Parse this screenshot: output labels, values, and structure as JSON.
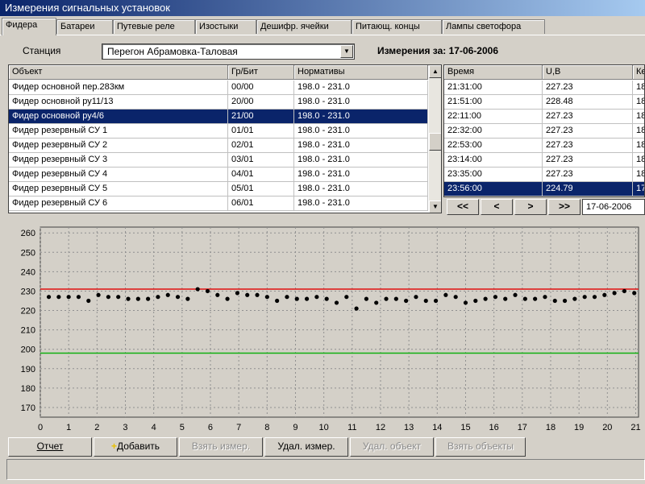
{
  "window": {
    "title": "Измерения сигнальных установок"
  },
  "tabs": [
    {
      "label": "Фидера",
      "active": true
    },
    {
      "label": "Батареи",
      "active": false
    },
    {
      "label": "Путевые реле",
      "active": false
    },
    {
      "label": "Изостыки",
      "active": false
    },
    {
      "label": "Дешифр. ячейки",
      "active": false
    },
    {
      "label": "Питающ. концы",
      "active": false
    },
    {
      "label": "Лампы светофора",
      "active": false
    }
  ],
  "station": {
    "label": "Станция",
    "value": "Перегон Абрамовка-Таловая"
  },
  "measure_date": {
    "text": "Измерения за: 17-06-2006"
  },
  "objects_table": {
    "headers": [
      "Объект",
      "Гр/Бит",
      "Нормативы"
    ],
    "rows": [
      {
        "object": "Фидер основной пер.283км",
        "grbit": "00/00",
        "norm": "198.0 - 231.0",
        "selected": false
      },
      {
        "object": "Фидер основной ру11/13",
        "grbit": "20/00",
        "norm": "198.0 - 231.0",
        "selected": false
      },
      {
        "object": "Фидер основной ру4/6",
        "grbit": "21/00",
        "norm": "198.0 - 231.0",
        "selected": true
      },
      {
        "object": "Фидер резервный СУ 1",
        "grbit": "01/01",
        "norm": "198.0 - 231.0",
        "selected": false
      },
      {
        "object": "Фидер резервный СУ 2",
        "grbit": "02/01",
        "norm": "198.0 - 231.0",
        "selected": false
      },
      {
        "object": "Фидер резервный СУ 3",
        "grbit": "03/01",
        "norm": "198.0 - 231.0",
        "selected": false
      },
      {
        "object": "Фидер резервный СУ 4",
        "grbit": "04/01",
        "norm": "198.0 - 231.0",
        "selected": false
      },
      {
        "object": "Фидер резервный СУ 5",
        "grbit": "05/01",
        "norm": "198.0 - 231.0",
        "selected": false
      },
      {
        "object": "Фидер резервный СУ 6",
        "grbit": "06/01",
        "norm": "198.0 - 231.0",
        "selected": false
      }
    ]
  },
  "measurements_table": {
    "headers": [
      "Время",
      "U,B",
      "Ке"
    ],
    "rows": [
      {
        "time": "21:31:00",
        "u": "227.23",
        "k": "18",
        "selected": false
      },
      {
        "time": "21:51:00",
        "u": "228.48",
        "k": "18",
        "selected": false
      },
      {
        "time": "22:11:00",
        "u": "227.23",
        "k": "18",
        "selected": false
      },
      {
        "time": "22:32:00",
        "u": "227.23",
        "k": "18",
        "selected": false
      },
      {
        "time": "22:53:00",
        "u": "227.23",
        "k": "18",
        "selected": false
      },
      {
        "time": "23:14:00",
        "u": "227.23",
        "k": "18",
        "selected": false
      },
      {
        "time": "23:35:00",
        "u": "227.23",
        "k": "18",
        "selected": false
      },
      {
        "time": "23:56:00",
        "u": "224.79",
        "k": "17",
        "selected": true
      }
    ]
  },
  "nav": {
    "first": "<<",
    "prev": "<",
    "next": ">",
    "last": ">>",
    "date": "17-06-2006"
  },
  "chart_data": {
    "type": "scatter",
    "ylim": [
      165,
      263
    ],
    "xlim": [
      0,
      21.1
    ],
    "yticks": [
      170,
      180,
      190,
      200,
      210,
      220,
      230,
      240,
      250,
      260
    ],
    "xticks": [
      0,
      1,
      2,
      3,
      4,
      5,
      6,
      7,
      8,
      9,
      10,
      11,
      12,
      13,
      14,
      15,
      16,
      17,
      18,
      19,
      20,
      21
    ],
    "upper_limit": 231,
    "lower_limit": 198,
    "upper_color": "#e01010",
    "lower_color": "#10b010",
    "grid": true,
    "x": [
      0.3,
      0.65,
      1.0,
      1.35,
      1.7,
      2.05,
      2.4,
      2.75,
      3.1,
      3.45,
      3.8,
      4.15,
      4.5,
      4.85,
      5.2,
      5.55,
      5.9,
      6.25,
      6.6,
      6.95,
      7.3,
      7.65,
      8.0,
      8.35,
      8.7,
      9.05,
      9.4,
      9.75,
      10.1,
      10.45,
      10.8,
      11.15,
      11.5,
      11.85,
      12.2,
      12.55,
      12.9,
      13.25,
      13.6,
      13.95,
      14.3,
      14.65,
      15.0,
      15.35,
      15.7,
      16.05,
      16.4,
      16.75,
      17.1,
      17.45,
      17.8,
      18.15,
      18.5,
      18.85,
      19.2,
      19.55,
      19.9,
      20.25,
      20.6,
      20.95
    ],
    "y": [
      227,
      227,
      227,
      227,
      225,
      228,
      227,
      227,
      226,
      226,
      226,
      227,
      228,
      227,
      226,
      231,
      230,
      228,
      226,
      229,
      228,
      228,
      227,
      225,
      227,
      226,
      226,
      227,
      226,
      224,
      227,
      221,
      226,
      224,
      226,
      226,
      225,
      227,
      225,
      225,
      228,
      227,
      224,
      225,
      226,
      227,
      226,
      228,
      226,
      226,
      227,
      225,
      225,
      226,
      227,
      227,
      228,
      229,
      230,
      229
    ]
  },
  "buttons": {
    "report": "Отчет",
    "add": "Добавить",
    "take_measure": "Взять измер.",
    "del_measure": "Удал. измер.",
    "del_object": "Удал. объект",
    "take_objects": "Взять объекты"
  }
}
